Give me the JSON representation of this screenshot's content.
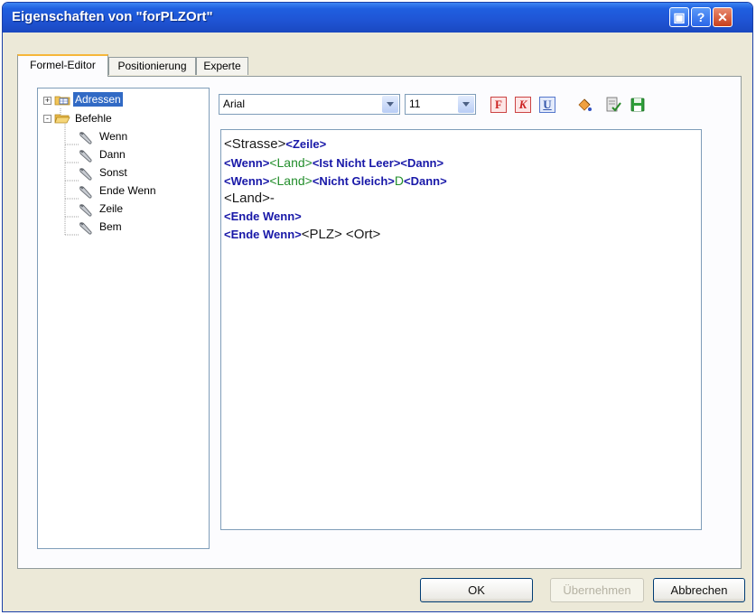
{
  "window": {
    "title": "Eigenschaften von \"forPLZOrt\""
  },
  "title_buttons": {
    "restore": "▣",
    "help": "?",
    "close": "✕"
  },
  "tabs": [
    {
      "label": "Formel-Editor",
      "active": true
    },
    {
      "label": "Positionierung",
      "active": false
    },
    {
      "label": "Experte",
      "active": false
    }
  ],
  "tree": {
    "nodes": [
      {
        "label": "Adressen",
        "expander": "+",
        "selected": true,
        "icon": "table-folder-icon"
      },
      {
        "label": "Befehle",
        "expander": "-",
        "icon": "open-folder-icon"
      }
    ],
    "commands": [
      {
        "label": "Wenn"
      },
      {
        "label": "Dann"
      },
      {
        "label": "Sonst"
      },
      {
        "label": "Ende Wenn"
      },
      {
        "label": "Zeile"
      },
      {
        "label": "Bem"
      }
    ]
  },
  "toolbar": {
    "font": "Arial",
    "size": "11",
    "format_buttons": [
      "F",
      "K",
      "U"
    ],
    "icons": [
      "paint-bucket-icon",
      "edit-check-icon",
      "save-icon"
    ]
  },
  "editor": {
    "lines": [
      [
        {
          "t": "<Strasse>",
          "s": "plain"
        },
        {
          "t": "<Zeile>",
          "s": "kw"
        }
      ],
      [
        {
          "t": "<Wenn>",
          "s": "kw"
        },
        {
          "t": "<Land>",
          "s": "fld"
        },
        {
          "t": "<Ist Nicht Leer>",
          "s": "kw"
        },
        {
          "t": "<Dann>",
          "s": "kw"
        }
      ],
      [
        {
          "t": "<Wenn>",
          "s": "kw"
        },
        {
          "t": "<Land>",
          "s": "fld"
        },
        {
          "t": "<Nicht Gleich>",
          "s": "kw"
        },
        {
          "t": "D",
          "s": "fld"
        },
        {
          "t": "<Dann>",
          "s": "kw"
        }
      ],
      [
        {
          "t": "<Land>-",
          "s": "plain"
        }
      ],
      [
        {
          "t": "<Ende Wenn>",
          "s": "kw"
        }
      ],
      [
        {
          "t": "<Ende Wenn>",
          "s": "kw"
        },
        {
          "t": "<PLZ> <Ort>",
          "s": "plain"
        }
      ]
    ]
  },
  "buttons": {
    "ok": "OK",
    "apply": "Übernehmen",
    "cancel": "Abbrechen"
  },
  "colors": {
    "keyword": "#1818a8",
    "field": "#238e2c",
    "selection": "#316ac5",
    "tab_highlight": "#f6b63a"
  }
}
